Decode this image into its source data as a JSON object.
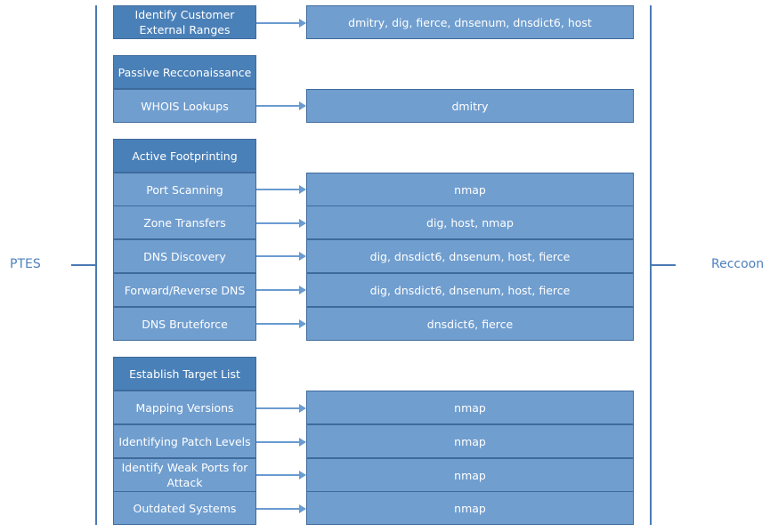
{
  "left_label": "PTES",
  "right_label": "Reccoon",
  "groups": [
    {
      "header": null,
      "rows": [
        {
          "phase": "Identify Customer External Ranges",
          "tools": "dmitry, dig, fierce, dnsenum, dnsdict6, host"
        }
      ]
    },
    {
      "header": "Passive Recconaissance",
      "rows": [
        {
          "phase": "WHOIS Lookups",
          "tools": "dmitry"
        }
      ]
    },
    {
      "header": "Active Footprinting",
      "rows": [
        {
          "phase": "Port Scanning",
          "tools": "nmap"
        },
        {
          "phase": "Zone Transfers",
          "tools": "dig, host, nmap"
        },
        {
          "phase": "DNS Discovery",
          "tools": "dig, dnsdict6, dnsenum, host, fierce"
        },
        {
          "phase": "Forward/Reverse DNS",
          "tools": "dig, dnsdict6, dnsenum, host, fierce"
        },
        {
          "phase": "DNS Bruteforce",
          "tools": "dnsdict6, fierce"
        }
      ]
    },
    {
      "header": "Establish Target List",
      "rows": [
        {
          "phase": "Mapping Versions",
          "tools": "nmap"
        },
        {
          "phase": "Identifying Patch Levels",
          "tools": "nmap"
        },
        {
          "phase": "Identify Weak Ports for Attack",
          "tools": "nmap"
        },
        {
          "phase": "Outdated Systems",
          "tools": "nmap"
        }
      ]
    }
  ]
}
